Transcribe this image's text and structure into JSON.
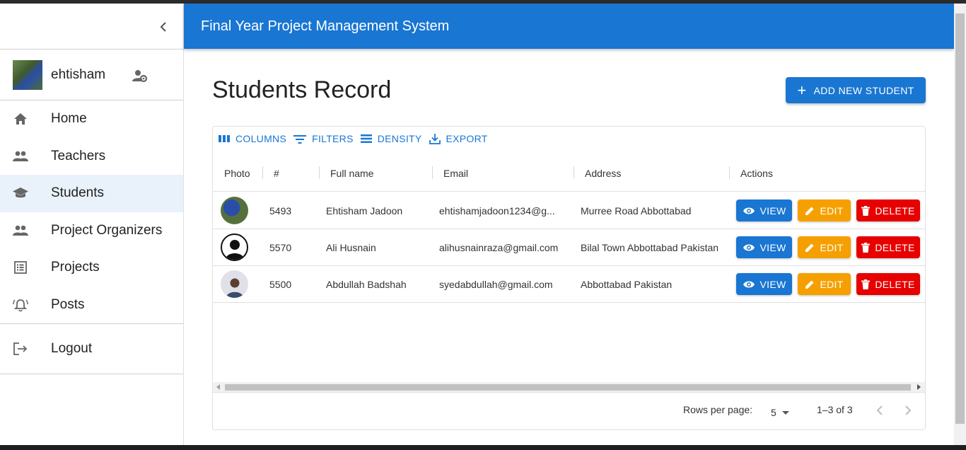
{
  "app": {
    "title": "Final Year Project Management System"
  },
  "user": {
    "name": "ehtisham"
  },
  "sidebar": {
    "items": [
      {
        "label": "Home",
        "icon": "home-icon"
      },
      {
        "label": "Teachers",
        "icon": "people-icon"
      },
      {
        "label": "Students",
        "icon": "school-icon",
        "active": true
      },
      {
        "label": "Project Organizers",
        "icon": "people-icon"
      },
      {
        "label": "Projects",
        "icon": "list-icon"
      },
      {
        "label": "Posts",
        "icon": "bell-icon"
      }
    ],
    "logout": "Logout"
  },
  "page": {
    "title": "Students Record",
    "add_button": "ADD NEW STUDENT"
  },
  "toolbar": {
    "columns": "COLUMNS",
    "filters": "FILTERS",
    "density": "DENSITY",
    "export": "EXPORT"
  },
  "table": {
    "columns": [
      "Photo",
      "#",
      "Full name",
      "Email",
      "Address",
      "Actions"
    ],
    "rows": [
      {
        "id": "5493",
        "name": "Ehtisham Jadoon",
        "email": "ehtishamjadoon1234@g...",
        "address": "Murree Road Abbottabad"
      },
      {
        "id": "5570",
        "name": "Ali Husnain",
        "email": "alihusnainraza@gmail.com",
        "address": "Bilal Town Abbottabad Pakistan"
      },
      {
        "id": "5500",
        "name": "Abdullah Badshah",
        "email": "syedabdullah@gmail.com",
        "address": "Abbottabad Pakistan"
      }
    ],
    "actions": {
      "view": "VIEW",
      "edit": "EDIT",
      "delete": "DELETE"
    }
  },
  "pagination": {
    "rows_per_page_label": "Rows per page:",
    "rows_per_page": "5",
    "range": "1–3 of 3"
  },
  "colors": {
    "primary": "#1976d2",
    "edit": "#f5a000",
    "delete": "#e60000",
    "active_nav": "#e9f1fb"
  }
}
